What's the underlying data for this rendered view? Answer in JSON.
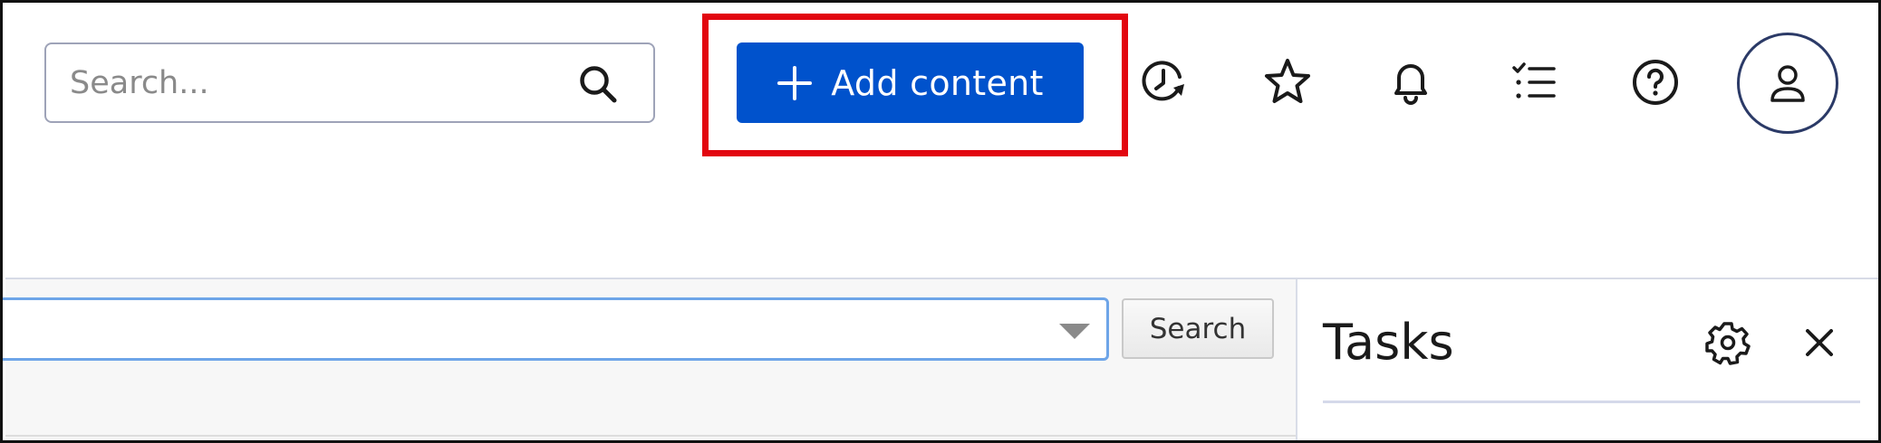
{
  "header": {
    "search": {
      "placeholder": "Search..."
    },
    "add_button": {
      "label": "Add content"
    },
    "icons": [
      "history-icon",
      "favorites-star-icon",
      "notifications-bell-icon",
      "tasks-list-icon",
      "help-icon",
      "user-avatar-icon"
    ]
  },
  "content": {
    "filter_search_button": "Search"
  },
  "tasks_panel": {
    "title": "Tasks"
  },
  "colors": {
    "primary_button": "#0052cc",
    "highlight": "#e2060f",
    "focus_border": "#6ea5e8",
    "avatar_border": "#2b3a67"
  }
}
